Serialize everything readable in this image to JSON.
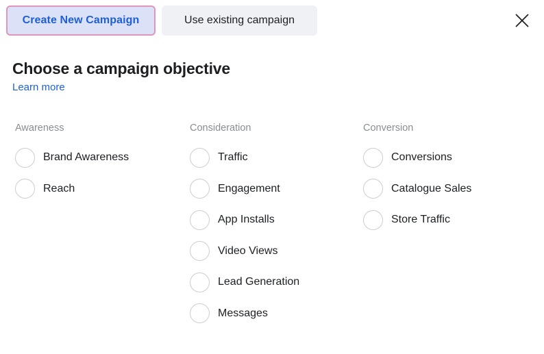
{
  "tabs": [
    {
      "label": "Create New Campaign",
      "selected": true
    },
    {
      "label": "Use existing campaign",
      "selected": false
    }
  ],
  "close": {
    "icon": "close-icon",
    "label": "Close"
  },
  "heading": {
    "title": "Choose a campaign objective",
    "learn_more": "Learn more"
  },
  "columns": [
    {
      "header": "Awareness",
      "options": [
        {
          "label": "Brand Awareness",
          "selected": false
        },
        {
          "label": "Reach",
          "selected": false
        }
      ]
    },
    {
      "header": "Consideration",
      "options": [
        {
          "label": "Traffic",
          "selected": false
        },
        {
          "label": "Engagement",
          "selected": false
        },
        {
          "label": "App Installs",
          "selected": false
        },
        {
          "label": "Video Views",
          "selected": false
        },
        {
          "label": "Lead Generation",
          "selected": false
        },
        {
          "label": "Messages",
          "selected": false
        }
      ]
    },
    {
      "header": "Conversion",
      "options": [
        {
          "label": "Conversions",
          "selected": false
        },
        {
          "label": "Catalogue Sales",
          "selected": false
        },
        {
          "label": "Store Traffic",
          "selected": false
        }
      ]
    }
  ],
  "colors": {
    "accent_blue": "#1b62d4",
    "selected_tab_bg": "#dbe2f7",
    "selected_tab_border": "#e295bb",
    "unselected_tab_bg": "#f0f1f4",
    "muted_text": "#8a8d91",
    "body_text": "#1c1e21",
    "radio_border": "#ccced2",
    "page_bg": "#ffffff"
  }
}
